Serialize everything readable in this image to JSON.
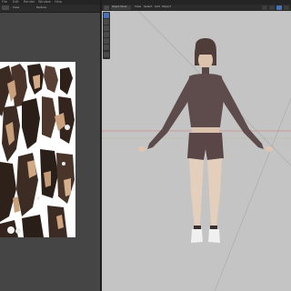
{
  "menubar": {
    "items": [
      "File",
      "Edit",
      "Render",
      "Window",
      "Help"
    ]
  },
  "image_editor": {
    "mode": "View",
    "image_name": "Texture"
  },
  "viewport": {
    "mode": "Object Mode",
    "view_label": "View",
    "select_label": "Select",
    "add_label": "Add",
    "object_label": "Object"
  },
  "colors": {
    "accent": "#4772b3",
    "viewport_bg": "#c4c4c4",
    "editor_bg": "#454545",
    "axis_red": "#d07070",
    "axis_green": "#8fb06a"
  },
  "icons": [
    "select-tool-icon",
    "cursor-tool-icon",
    "move-tool-icon",
    "rotate-tool-icon",
    "scale-tool-icon",
    "transform-tool-icon",
    "annotate-tool-icon"
  ]
}
